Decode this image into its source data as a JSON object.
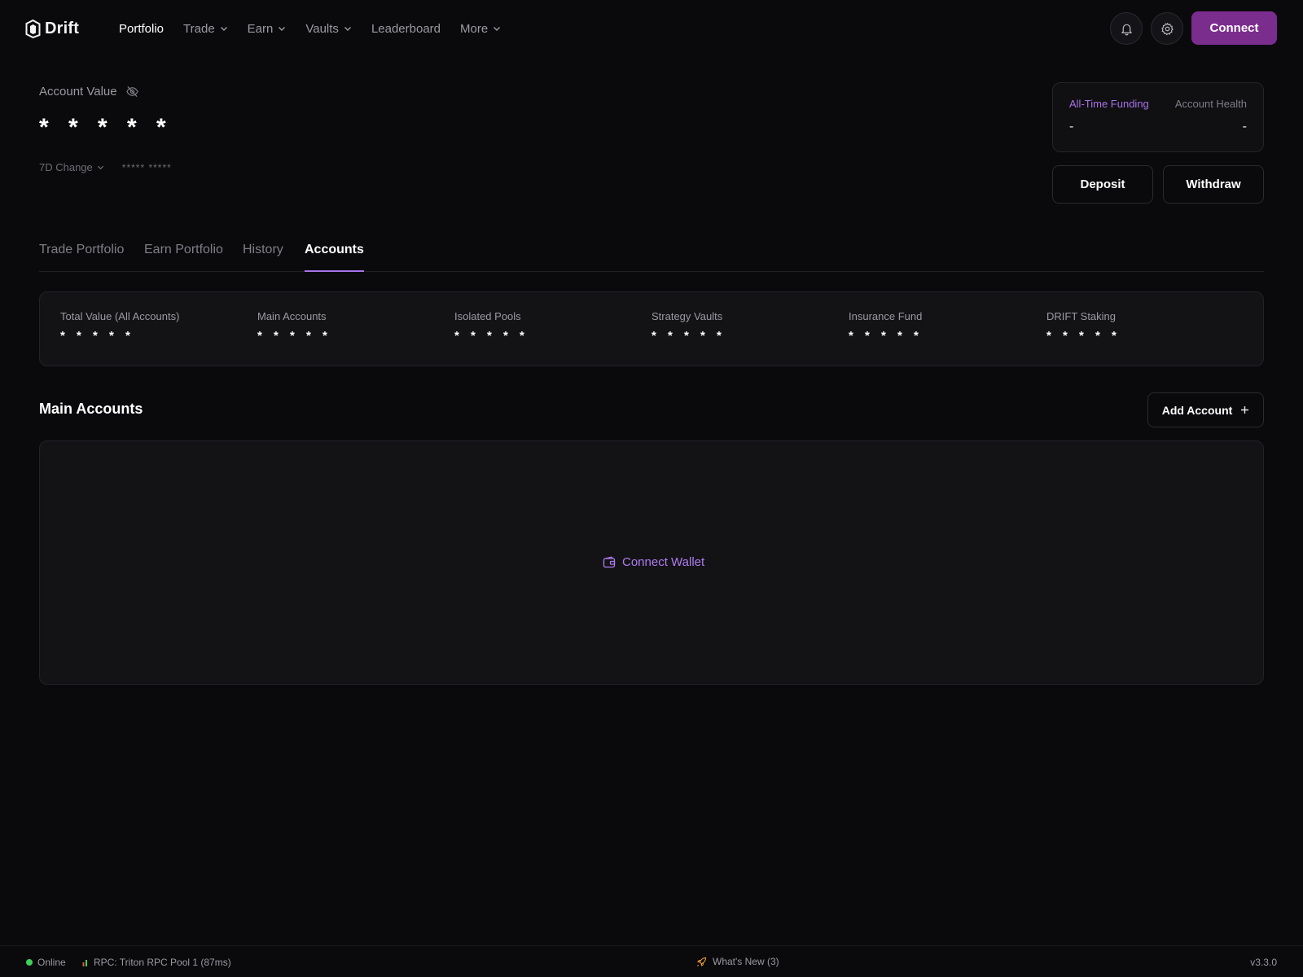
{
  "brand": {
    "name": "Drift"
  },
  "nav": {
    "items": [
      {
        "label": "Portfolio",
        "active": true,
        "dropdown": false
      },
      {
        "label": "Trade",
        "active": false,
        "dropdown": true
      },
      {
        "label": "Earn",
        "active": false,
        "dropdown": true
      },
      {
        "label": "Vaults",
        "active": false,
        "dropdown": true
      },
      {
        "label": "Leaderboard",
        "active": false,
        "dropdown": false
      },
      {
        "label": "More",
        "active": false,
        "dropdown": true
      }
    ],
    "connect_label": "Connect",
    "icons": [
      "bell-icon",
      "gear-icon"
    ]
  },
  "account": {
    "label": "Account Value",
    "value": "* * * * *",
    "change_label": "7D Change",
    "change_value": "***** *****"
  },
  "funding": {
    "all_time_label": "All-Time Funding",
    "all_time_value": "-",
    "health_label": "Account Health",
    "health_value": "-"
  },
  "actions": {
    "deposit": "Deposit",
    "withdraw": "Withdraw"
  },
  "tabs": [
    {
      "label": "Trade Portfolio",
      "active": false
    },
    {
      "label": "Earn Portfolio",
      "active": false
    },
    {
      "label": "History",
      "active": false
    },
    {
      "label": "Accounts",
      "active": true
    }
  ],
  "stats": [
    {
      "label": "Total Value (All Accounts)",
      "value": "* * * * *"
    },
    {
      "label": "Main Accounts",
      "value": "* * * * *"
    },
    {
      "label": "Isolated Pools",
      "value": "* * * * *"
    },
    {
      "label": "Strategy Vaults",
      "value": "* * * * *"
    },
    {
      "label": "Insurance Fund",
      "value": "* * * * *"
    },
    {
      "label": "DRIFT Staking",
      "value": "* * * * *"
    }
  ],
  "main_accounts": {
    "title": "Main Accounts",
    "add_label": "Add Account",
    "connect_wallet_label": "Connect Wallet"
  },
  "footer": {
    "status": "Online",
    "rpc": "RPC: Triton RPC Pool 1 (87ms)",
    "whats_new": "What's New (3)",
    "version": "v3.3.0"
  },
  "colors": {
    "background": "#0a0a0c",
    "accent": "#7b2d8e",
    "accent_text": "#a873e8",
    "online": "#3fcf5a",
    "panel": "#131316"
  }
}
